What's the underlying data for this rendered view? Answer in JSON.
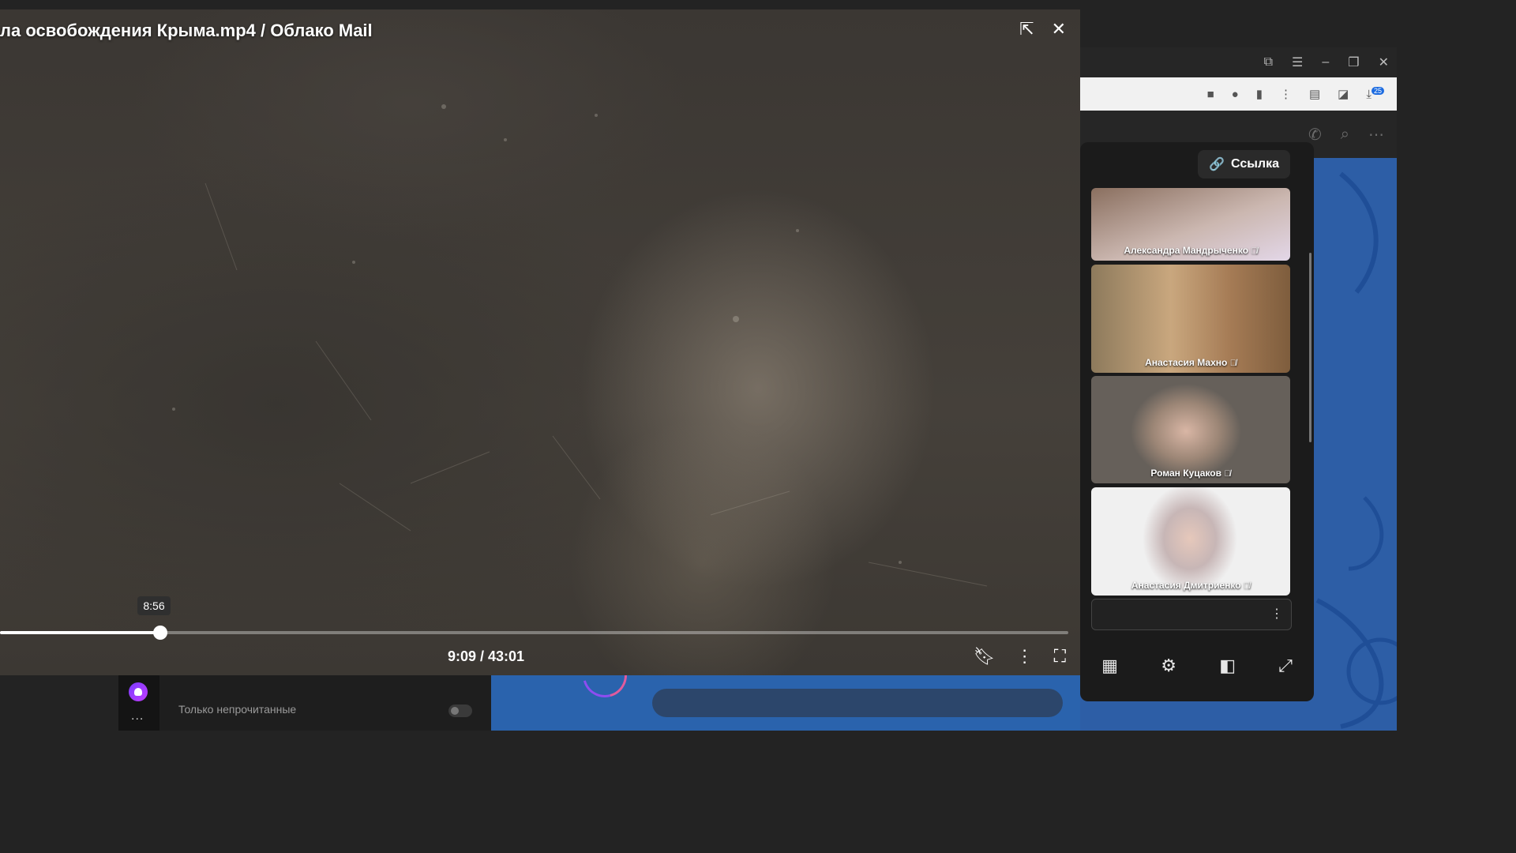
{
  "video": {
    "title": "ла освобождения Крыма.mp4 / Облако Mail",
    "tooltip": "8:56",
    "time": "9:09 / 43:01",
    "progress_fraction": 0.213,
    "icons": {
      "exit_fullscreen": "exit-fullscreen-icon",
      "close": "close-icon",
      "bookmark": "bookmark-icon",
      "more": "more-vertical-icon",
      "fullscreen": "fullscreen-icon"
    }
  },
  "call": {
    "link_label": "Ссылка",
    "participants": [
      {
        "name": "Александра Мандрыченко",
        "muted": true
      },
      {
        "name": "Анастасия Махно",
        "muted": true
      },
      {
        "name": "Роман Куцаков",
        "muted": true
      },
      {
        "name": "Анастасия Дмитриенко",
        "muted": true
      }
    ]
  },
  "chat": {
    "unread_label": "Только непрочитанные",
    "more": "..."
  },
  "browser": {
    "download_badge": "25"
  }
}
